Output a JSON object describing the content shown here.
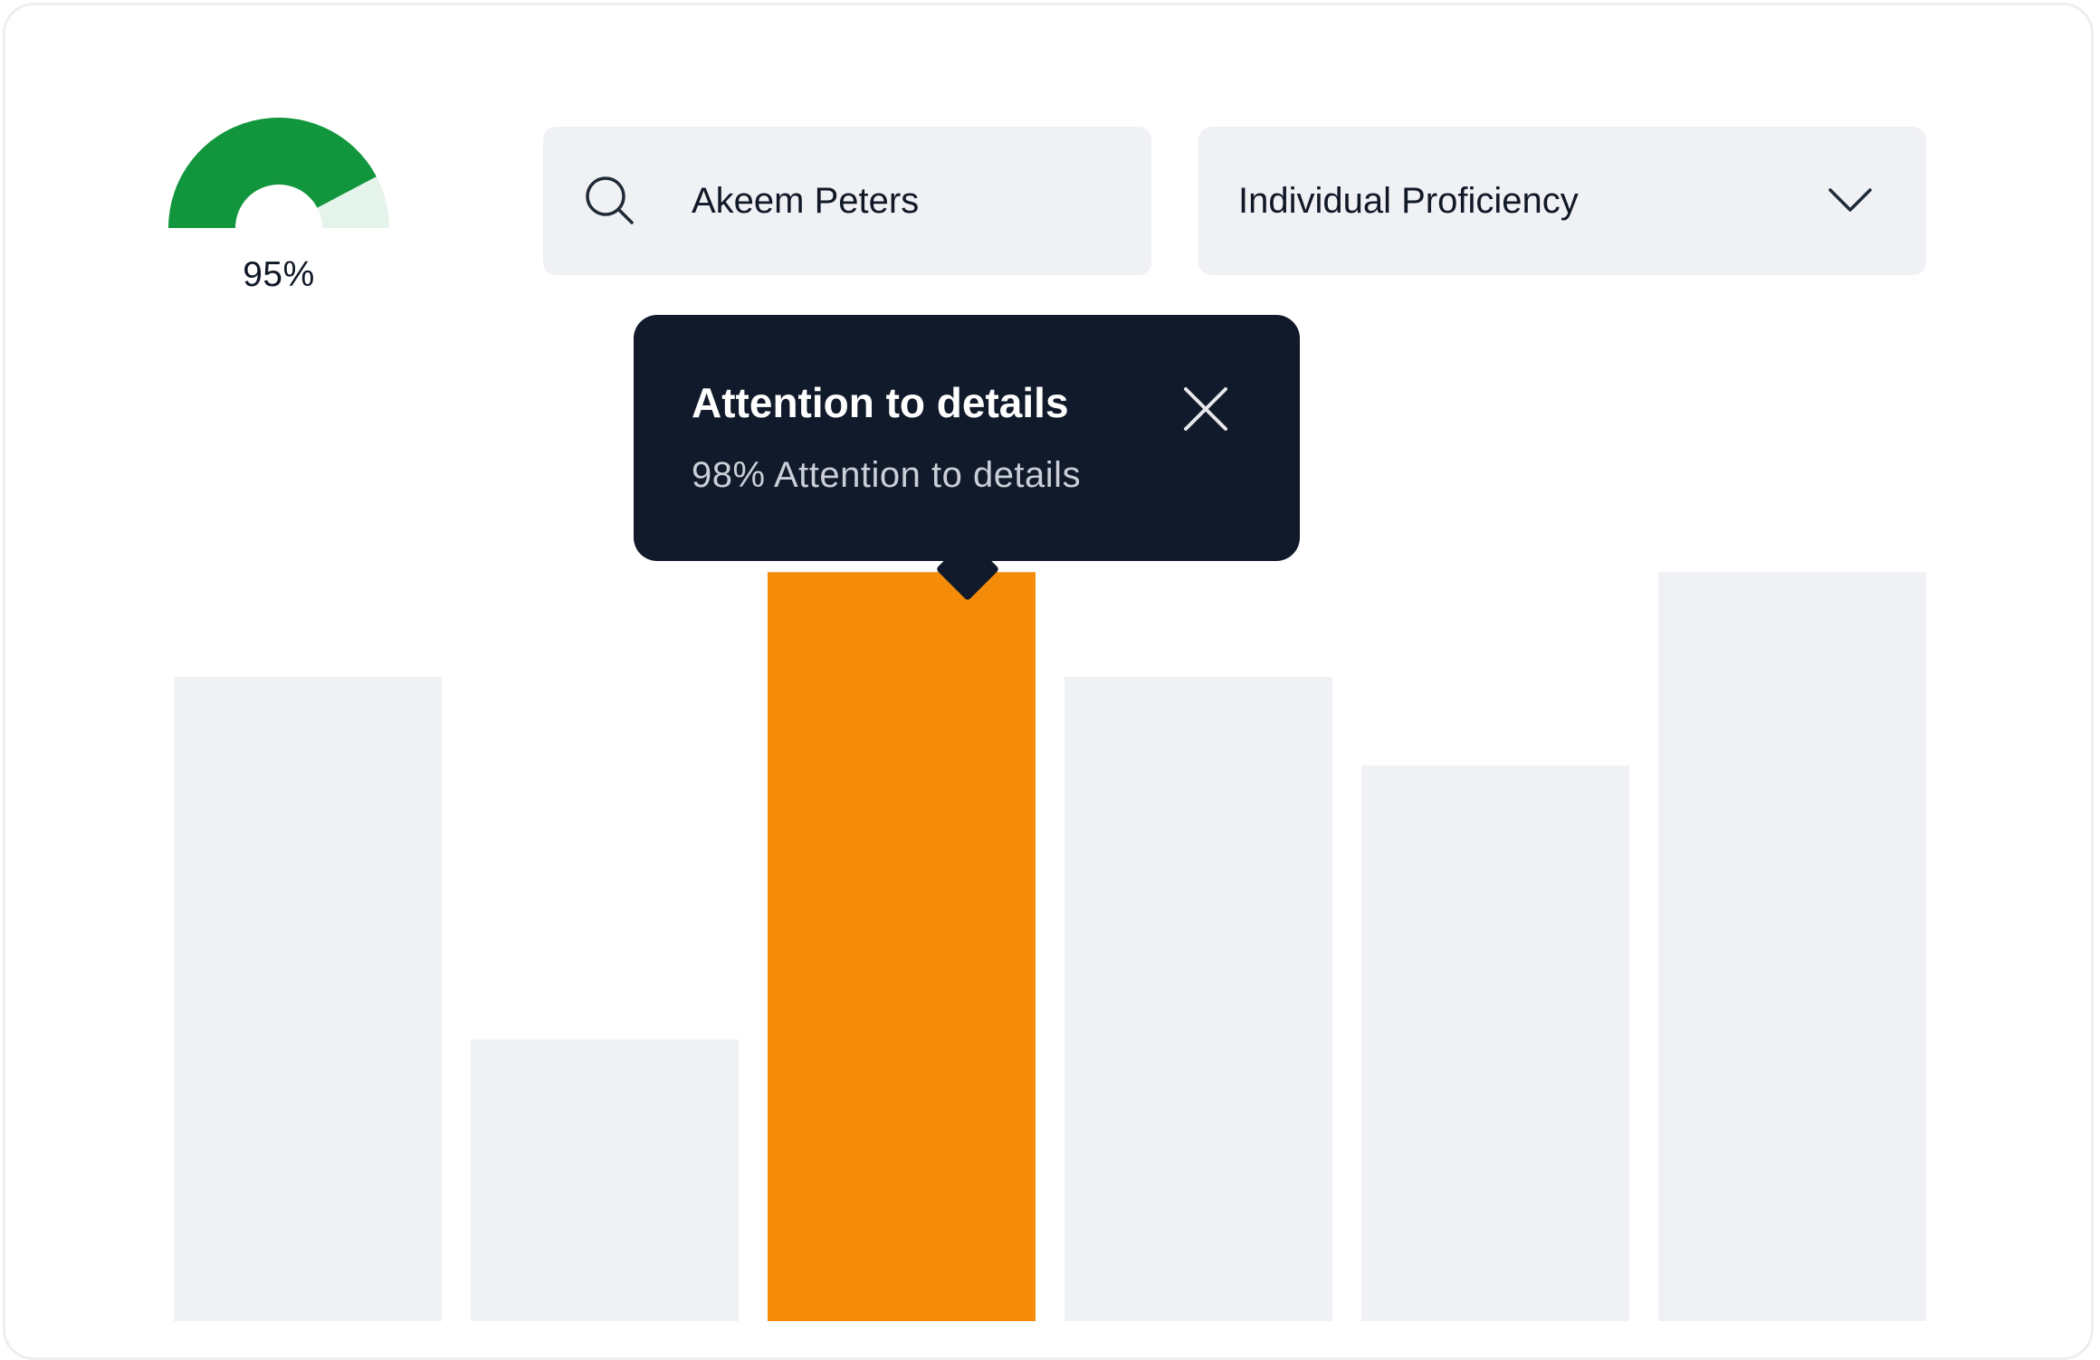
{
  "gauge": {
    "value": 0.95,
    "label": "95%",
    "fill_color": "#12963d",
    "track_color": "#e4f4ea"
  },
  "search": {
    "value": "Akeem Peters",
    "icon": "search-icon"
  },
  "filter": {
    "selected": "Individual Proficiency",
    "icon": "chevron-down-icon"
  },
  "tooltip": {
    "title": "Attention to details",
    "subtitle": "98% Attention to details",
    "close_icon": "close-icon",
    "background": "#111a2a"
  },
  "chart_data": {
    "type": "bar",
    "values": [
      80,
      35,
      93,
      80,
      69,
      93
    ],
    "highlight_index": 2,
    "ylim": [
      0,
      100
    ],
    "bar_color": "#f0f1f4",
    "highlight_color": "#f48b09",
    "grid": false
  }
}
